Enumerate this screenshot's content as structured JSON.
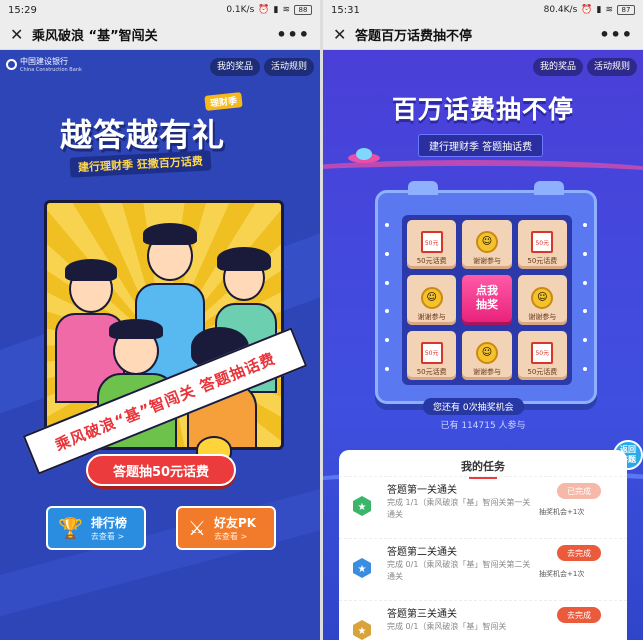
{
  "left": {
    "status": {
      "time": "15:29",
      "speed": "0.1K/s",
      "battery": "88"
    },
    "nav": {
      "close": "✕",
      "title": "乘风破浪 “基”智闯关",
      "more": "•••"
    },
    "bank": {
      "name": "中国建设银行",
      "name_en": "China Construction Bank"
    },
    "buttons": {
      "my_prizes": "我的奖品",
      "rules": "活动规则"
    },
    "tag": "理财季",
    "headline": "越答越有礼",
    "subheadline": "建行理财季 狂撒百万话费",
    "ribbon_text": "乘风破浪“基”智闯关 答题抽话费",
    "cta": "答题抽50元话费",
    "cards": [
      {
        "title": "排行榜",
        "sub": "去查看 >",
        "icon": "trophy-icon",
        "color": "#2a8de0"
      },
      {
        "title": "好友PK",
        "sub": "去查看 >",
        "icon": "swords-icon",
        "color": "#f17b2a"
      }
    ]
  },
  "right": {
    "status": {
      "time": "15:31",
      "speed": "80.4K/s",
      "battery": "87"
    },
    "nav": {
      "close": "✕",
      "title": "答题百万话费抽不停",
      "more": "•••"
    },
    "buttons": {
      "my_prizes": "我的奖品",
      "rules": "活动规则"
    },
    "headline": "百万话费抽不停",
    "subheadline": "建行理财季 答题抽话费",
    "grid": [
      {
        "type": "ticket",
        "ticket_text": "50元",
        "label": "50元话费"
      },
      {
        "type": "smile",
        "label": "谢谢参与"
      },
      {
        "type": "ticket",
        "ticket_text": "50元",
        "label": "50元话费"
      },
      {
        "type": "smile",
        "label": "谢谢参与"
      },
      {
        "type": "draw",
        "label": "点我\n抽奖"
      },
      {
        "type": "smile",
        "label": "谢谢参与"
      },
      {
        "type": "ticket",
        "ticket_text": "50元",
        "label": "50元话费"
      },
      {
        "type": "smile",
        "label": "谢谢参与"
      },
      {
        "type": "ticket",
        "ticket_text": "50元",
        "label": "50元话费"
      }
    ],
    "chances": "您还有 0次抽奖机会",
    "participants": "已有 114715 人参与",
    "side_button": "返回\n答题",
    "tasks_title": "我的任务",
    "tasks": [
      {
        "title": "答题第一关通关",
        "desc": "完成 1/1（乘风破浪「基」智闯关第一关通关",
        "button": "已完成",
        "state": "done",
        "reward": "抽奖机会+1次",
        "badge_color": "#3bb56a"
      },
      {
        "title": "答题第二关通关",
        "desc": "完成 0/1（乘风破浪「基」智闯关第二关通关",
        "button": "去完成",
        "state": "go",
        "reward": "抽奖机会+1次",
        "badge_color": "#3a8de0"
      },
      {
        "title": "答题第三关通关",
        "desc": "完成 0/1（乘风破浪「基」智闯关",
        "button": "去完成",
        "state": "go",
        "reward": "",
        "badge_color": "#d9a23a"
      }
    ]
  }
}
